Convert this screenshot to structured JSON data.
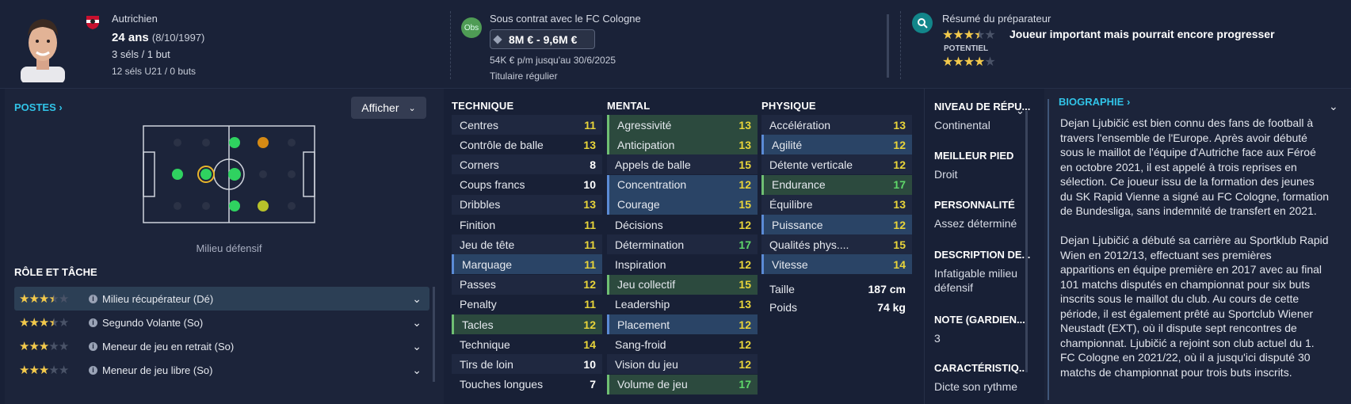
{
  "player": {
    "nationality": "Autrichien",
    "age": "24 ans",
    "dob": "(8/10/1997)",
    "caps": "3 séls / 1 but",
    "u21": "12 séls U21 / 0 buts"
  },
  "contract": {
    "badge": "Obs",
    "club_line": "Sous contrat avec le FC Cologne",
    "value": "8M € - 9,6M €",
    "wage": "54K € p/m jusqu'au 30/6/2025",
    "status": "Titulaire régulier"
  },
  "coach": {
    "title": "Résumé du préparateur",
    "summary": "Joueur important mais pourrait encore progresser",
    "potential_label": "POTENTIEL",
    "ability_stars": 3.5,
    "potential_stars": 4
  },
  "positions": {
    "title": "POSTES",
    "show_button": "Afficher",
    "position_label": "Milieu défensif"
  },
  "roles": {
    "title": "RÔLE ET TÂCHE",
    "items": [
      {
        "label": "Milieu récupérateur (Dé)",
        "stars": 3.5
      },
      {
        "label": "Segundo Volante (So)",
        "stars": 3.5
      },
      {
        "label": "Meneur de jeu en retrait (So)",
        "stars": 3
      },
      {
        "label": "Meneur de jeu libre (So)",
        "stars": 3
      }
    ]
  },
  "technique": {
    "title": "TECHNIQUE",
    "rows": [
      {
        "label": "Centres",
        "value": "11",
        "color": "#e8d43a",
        "hl": ""
      },
      {
        "label": "Contrôle de balle",
        "value": "13",
        "color": "#e8d43a",
        "hl": ""
      },
      {
        "label": "Corners",
        "value": "8",
        "color": "#ffffff",
        "hl": ""
      },
      {
        "label": "Coups francs",
        "value": "10",
        "color": "#ffffff",
        "hl": ""
      },
      {
        "label": "Dribbles",
        "value": "13",
        "color": "#e8d43a",
        "hl": ""
      },
      {
        "label": "Finition",
        "value": "11",
        "color": "#e8d43a",
        "hl": ""
      },
      {
        "label": "Jeu de tête",
        "value": "11",
        "color": "#e8d43a",
        "hl": ""
      },
      {
        "label": "Marquage",
        "value": "11",
        "color": "#e8d43a",
        "hl": "blue"
      },
      {
        "label": "Passes",
        "value": "12",
        "color": "#e8d43a",
        "hl": ""
      },
      {
        "label": "Penalty",
        "value": "11",
        "color": "#e8d43a",
        "hl": ""
      },
      {
        "label": "Tacles",
        "value": "12",
        "color": "#e8d43a",
        "hl": "green"
      },
      {
        "label": "Technique",
        "value": "14",
        "color": "#e8d43a",
        "hl": ""
      },
      {
        "label": "Tirs de loin",
        "value": "10",
        "color": "#ffffff",
        "hl": ""
      },
      {
        "label": "Touches longues",
        "value": "7",
        "color": "#ffffff",
        "hl": ""
      }
    ]
  },
  "mental": {
    "title": "MENTAL",
    "rows": [
      {
        "label": "Agressivité",
        "value": "13",
        "color": "#e8d43a",
        "hl": "green"
      },
      {
        "label": "Anticipation",
        "value": "13",
        "color": "#e8d43a",
        "hl": "green"
      },
      {
        "label": "Appels de balle",
        "value": "15",
        "color": "#e8d43a",
        "hl": ""
      },
      {
        "label": "Concentration",
        "value": "12",
        "color": "#e8d43a",
        "hl": "blue"
      },
      {
        "label": "Courage",
        "value": "15",
        "color": "#e8d43a",
        "hl": "blue"
      },
      {
        "label": "Décisions",
        "value": "12",
        "color": "#e8d43a",
        "hl": ""
      },
      {
        "label": "Détermination",
        "value": "17",
        "color": "#5fd86a",
        "hl": ""
      },
      {
        "label": "Inspiration",
        "value": "12",
        "color": "#e8d43a",
        "hl": ""
      },
      {
        "label": "Jeu collectif",
        "value": "15",
        "color": "#e8d43a",
        "hl": "green"
      },
      {
        "label": "Leadership",
        "value": "13",
        "color": "#e8d43a",
        "hl": ""
      },
      {
        "label": "Placement",
        "value": "12",
        "color": "#e8d43a",
        "hl": "blue"
      },
      {
        "label": "Sang-froid",
        "value": "12",
        "color": "#e8d43a",
        "hl": ""
      },
      {
        "label": "Vision du jeu",
        "value": "12",
        "color": "#e8d43a",
        "hl": ""
      },
      {
        "label": "Volume de jeu",
        "value": "17",
        "color": "#5fd86a",
        "hl": "green"
      }
    ]
  },
  "physique": {
    "title": "PHYSIQUE",
    "rows": [
      {
        "label": "Accélération",
        "value": "13",
        "color": "#e8d43a",
        "hl": ""
      },
      {
        "label": "Agilité",
        "value": "12",
        "color": "#e8d43a",
        "hl": "blue"
      },
      {
        "label": "Détente verticale",
        "value": "12",
        "color": "#e8d43a",
        "hl": ""
      },
      {
        "label": "Endurance",
        "value": "17",
        "color": "#5fd86a",
        "hl": "green"
      },
      {
        "label": "Équilibre",
        "value": "13",
        "color": "#e8d43a",
        "hl": ""
      },
      {
        "label": "Puissance",
        "value": "12",
        "color": "#e8d43a",
        "hl": "blue"
      },
      {
        "label": "Qualités phys....",
        "value": "15",
        "color": "#e8d43a",
        "hl": ""
      },
      {
        "label": "Vitesse",
        "value": "14",
        "color": "#e8d43a",
        "hl": "blue"
      }
    ],
    "height_label": "Taille",
    "height": "187 cm",
    "weight_label": "Poids",
    "weight": "74 kg"
  },
  "info": [
    {
      "head": "NIVEAU DE RÉPU...",
      "val": "Continental"
    },
    {
      "head": "MEILLEUR PIED",
      "val": "Droit"
    },
    {
      "head": "PERSONNALITÉ",
      "val": "Assez déterminé"
    },
    {
      "head": "DESCRIPTION DE...",
      "val": "Infatigable milieu défensif"
    },
    {
      "head": "NOTE (GARDIEN...",
      "val": "3"
    },
    {
      "head": "CARACTÉRISTIQ...",
      "val": "Dicte son rythme"
    }
  ],
  "bio": {
    "title": "BIOGRAPHIE",
    "lines1": [
      "Dejan Ljubičić est bien connu des fans de football à",
      "travers l'ensemble de l'Europe. Après avoir débuté",
      "sous le maillot de l'équipe d'Autriche face aux Féroé",
      "en octobre 2021, il est appelé à trois reprises en",
      "sélection. Ce joueur issu de la formation des jeunes",
      "du SK Rapid Vienne a signé au FC Cologne, formation",
      "de Bundesliga, sans indemnité de transfert en 2021."
    ],
    "lines2": [
      "Dejan Ljubičić a débuté sa carrière au Sportklub Rapid",
      "Wien en 2012/13, effectuant ses premières",
      "apparitions en équipe première en 2017 avec au final",
      "101 matchs disputés en championnat pour six buts",
      "inscrits sous le maillot du club. Au cours de cette",
      "période, il est également prêté au Sportclub Wiener",
      "Neustadt (EXT), où il dispute sept rencontres de",
      "championnat. Ljubičić a rejoint son club actuel du 1.",
      "FC Cologne en 2021/22, où il a jusqu'ici disputé 30",
      "matchs de championnat pour trois buts inscrits."
    ]
  },
  "colors": {
    "accent": "#31c4e8",
    "star": "#f2c94c",
    "green": "#5fd86a",
    "yellow": "#e8d43a"
  }
}
